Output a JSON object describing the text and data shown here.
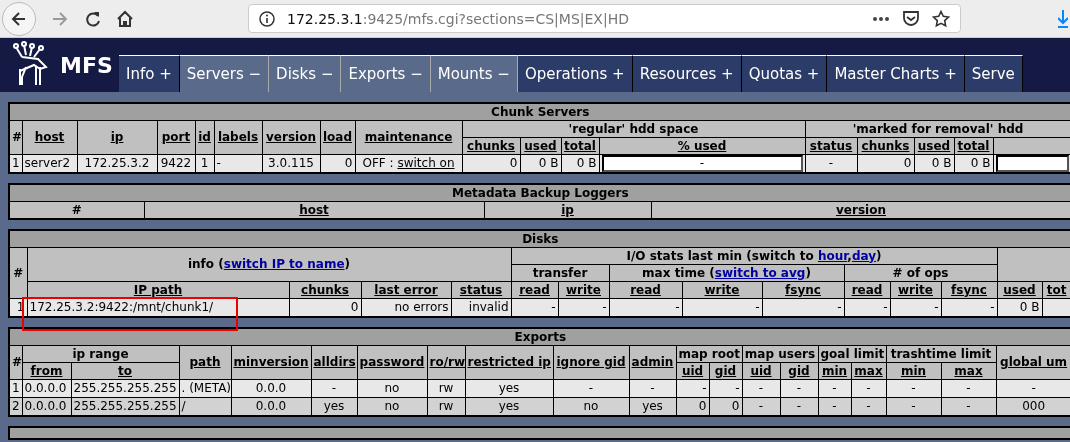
{
  "browser": {
    "url_host": "172.25.3.1",
    "url_rest": ":9425/mfs.cgi?sections=CS|MS|EX|HD"
  },
  "logo": {
    "text": "MFS"
  },
  "tabs": [
    {
      "label": "Info +",
      "expanded": false
    },
    {
      "label": "Servers −",
      "expanded": true
    },
    {
      "label": "Disks −",
      "expanded": true
    },
    {
      "label": "Exports −",
      "expanded": true
    },
    {
      "label": "Mounts −",
      "expanded": true
    },
    {
      "label": "Operations +",
      "expanded": false
    },
    {
      "label": "Resources +",
      "expanded": false
    },
    {
      "label": "Quotas +",
      "expanded": false
    },
    {
      "label": "Master Charts +",
      "expanded": false
    },
    {
      "label": "Serve",
      "expanded": false
    }
  ],
  "sections": [
    {
      "title": "Chunk Servers",
      "header_rows": [
        [
          {
            "text": "#",
            "rowspan": 2
          },
          {
            "text": "host",
            "sortable": true,
            "rowspan": 2
          },
          {
            "text": "ip",
            "sortable": true,
            "rowspan": 2
          },
          {
            "text": "port",
            "sortable": true,
            "rowspan": 2
          },
          {
            "text": "id",
            "sortable": true,
            "rowspan": 2
          },
          {
            "text": "labels",
            "sortable": true,
            "rowspan": 2
          },
          {
            "text": "version",
            "sortable": true,
            "rowspan": 2
          },
          {
            "text": "load",
            "sortable": true,
            "rowspan": 2
          },
          {
            "text": "maintenance",
            "sortable": true,
            "rowspan": 2
          },
          {
            "text": "'regular' hdd space",
            "colspan": 4
          },
          {
            "text": "'marked for removal' hdd",
            "colspan": 5
          }
        ],
        [
          {
            "text": "chunks",
            "sortable": true
          },
          {
            "text": "used",
            "sortable": true
          },
          {
            "text": "total",
            "sortable": true
          },
          {
            "text": "% used",
            "sortable": true
          },
          {
            "text": "status",
            "sortable": true
          },
          {
            "text": "chunks",
            "sortable": true
          },
          {
            "text": "used",
            "sortable": true
          },
          {
            "text": "total",
            "sortable": true
          },
          {}
        ]
      ],
      "rows": [
        [
          {
            "text": "1"
          },
          {
            "text": "server2"
          },
          {
            "text": "172.25.3.2"
          },
          {
            "text": "9422"
          },
          {
            "text": "1"
          },
          {
            "text": "-"
          },
          {
            "text": "3.0.115"
          },
          {
            "text": "0"
          },
          {
            "parts": [
              {
                "text": "OFF : "
              },
              {
                "text": "switch on",
                "link": true
              }
            ]
          },
          {
            "text": "0"
          },
          {
            "text": "0 B"
          },
          {
            "text": "0 B"
          },
          {
            "kind": "bar",
            "text": "-"
          },
          {
            "text": "-"
          },
          {
            "text": "0"
          },
          {
            "text": "0 B"
          },
          {
            "text": "0 B"
          },
          {
            "kind": "bar"
          }
        ]
      ]
    },
    {
      "title": "Metadata Backup Loggers",
      "header_rows": [
        [
          {
            "text": "#"
          },
          {
            "text": "host",
            "sortable": true
          },
          {
            "text": "ip",
            "sortable": true
          },
          {
            "text": "version",
            "sortable": true
          }
        ]
      ]
    },
    {
      "title": "Disks",
      "header_rows": [
        [
          {
            "text": "#",
            "rowspan": 3
          },
          {
            "parts": [
              {
                "text": "info ("
              },
              {
                "text": "switch IP to name",
                "link": true
              },
              {
                "text": ")"
              }
            ],
            "colspan": 4,
            "rowspan": 2
          },
          {
            "parts": [
              {
                "text": "I/O stats last min (switch to "
              },
              {
                "text": "hour",
                "link": true
              },
              {
                "text": ","
              },
              {
                "text": "day",
                "link": true
              },
              {
                "text": ")"
              }
            ],
            "colspan": 8
          },
          {
            "colspan": 2,
            "rowspan": 2
          }
        ],
        [
          {
            "text": "transfer",
            "colspan": 2
          },
          {
            "parts": [
              {
                "text": "max time ("
              },
              {
                "text": "switch to avg",
                "link": true
              },
              {
                "text": ")"
              }
            ],
            "colspan": 3
          },
          {
            "text": "# of ops",
            "colspan": 3
          }
        ],
        [
          {
            "text": "IP path",
            "sortable": true
          },
          {
            "text": "chunks",
            "sortable": true
          },
          {
            "text": "last error",
            "sortable": true
          },
          {
            "text": "status",
            "sortable": true
          },
          {
            "text": "read",
            "sortable": true
          },
          {
            "text": "write",
            "sortable": true
          },
          {
            "text": "read",
            "sortable": true
          },
          {
            "text": "write",
            "sortable": true
          },
          {
            "text": "fsync",
            "sortable": true
          },
          {
            "text": "read",
            "sortable": true
          },
          {
            "text": "write",
            "sortable": true
          },
          {
            "text": "fsync",
            "sortable": true
          },
          {
            "text": "used",
            "sortable": true
          },
          {
            "text": "tot",
            "sortable": true
          }
        ]
      ],
      "rows": [
        [
          {
            "text": "1"
          },
          {
            "text": "172.25.3.2:9422:/mnt/chunk1/",
            "annotated": true
          },
          {
            "text": "0"
          },
          {
            "text": "no errors"
          },
          {
            "text": "invalid"
          },
          {
            "text": "-"
          },
          {
            "text": "-"
          },
          {
            "text": "-"
          },
          {
            "text": "-"
          },
          {
            "text": "-"
          },
          {
            "text": "-"
          },
          {
            "text": "-"
          },
          {
            "text": "-"
          },
          {
            "text": "0 B"
          },
          {}
        ]
      ]
    },
    {
      "title": "Exports",
      "header_rows": [
        [
          {
            "text": "#",
            "rowspan": 2
          },
          {
            "text": "ip range",
            "colspan": 2
          },
          {
            "text": "path",
            "sortable": true,
            "rowspan": 2
          },
          {
            "text": "minversion",
            "sortable": true,
            "rowspan": 2
          },
          {
            "text": "alldirs",
            "sortable": true,
            "rowspan": 2
          },
          {
            "text": "password",
            "sortable": true,
            "rowspan": 2
          },
          {
            "text": "ro/rw",
            "sortable": true,
            "rowspan": 2
          },
          {
            "text": "restricted ip",
            "sortable": true,
            "rowspan": 2
          },
          {
            "text": "ignore gid",
            "sortable": true,
            "rowspan": 2
          },
          {
            "text": "admin",
            "sortable": true,
            "rowspan": 2
          },
          {
            "text": "map root",
            "colspan": 2
          },
          {
            "text": "map users",
            "colspan": 2
          },
          {
            "text": "goal limit",
            "colspan": 2
          },
          {
            "text": "trashtime limit",
            "colspan": 2
          },
          {
            "text": "global um",
            "sortable": true,
            "rowspan": 2
          }
        ],
        [
          {
            "text": "from",
            "sortable": true
          },
          {
            "text": "to",
            "sortable": true
          },
          {
            "text": "uid",
            "sortable": true
          },
          {
            "text": "gid",
            "sortable": true
          },
          {
            "text": "uid",
            "sortable": true
          },
          {
            "text": "gid",
            "sortable": true
          },
          {
            "text": "min",
            "sortable": true
          },
          {
            "text": "max",
            "sortable": true
          },
          {
            "text": "min",
            "sortable": true
          },
          {
            "text": "max",
            "sortable": true
          }
        ]
      ],
      "rows": [
        [
          {
            "text": "1"
          },
          {
            "text": "0.0.0.0"
          },
          {
            "text": "255.255.255.255"
          },
          {
            "text": ". (META)"
          },
          {
            "text": "0.0.0"
          },
          {
            "text": "-"
          },
          {
            "text": "no"
          },
          {
            "text": "rw"
          },
          {
            "text": "yes"
          },
          {
            "text": "-"
          },
          {
            "text": "-"
          },
          {
            "text": "-"
          },
          {
            "text": "-"
          },
          {
            "text": "-"
          },
          {
            "text": "-"
          },
          {
            "text": "-"
          },
          {
            "text": "-"
          },
          {
            "text": "-"
          },
          {
            "text": "-"
          },
          {
            "text": "-"
          }
        ],
        [
          {
            "text": "2"
          },
          {
            "text": "0.0.0.0"
          },
          {
            "text": "255.255.255.255"
          },
          {
            "text": "/"
          },
          {
            "text": "0.0.0"
          },
          {
            "text": "yes"
          },
          {
            "text": "no"
          },
          {
            "text": "rw"
          },
          {
            "text": "yes"
          },
          {
            "text": "no"
          },
          {
            "text": "yes"
          },
          {
            "text": "0"
          },
          {
            "text": "0"
          },
          {
            "text": "-"
          },
          {
            "text": "-"
          },
          {
            "text": "-"
          },
          {
            "text": "-"
          },
          {
            "text": "-"
          },
          {
            "text": "-"
          },
          {
            "text": "000"
          }
        ]
      ]
    }
  ]
}
